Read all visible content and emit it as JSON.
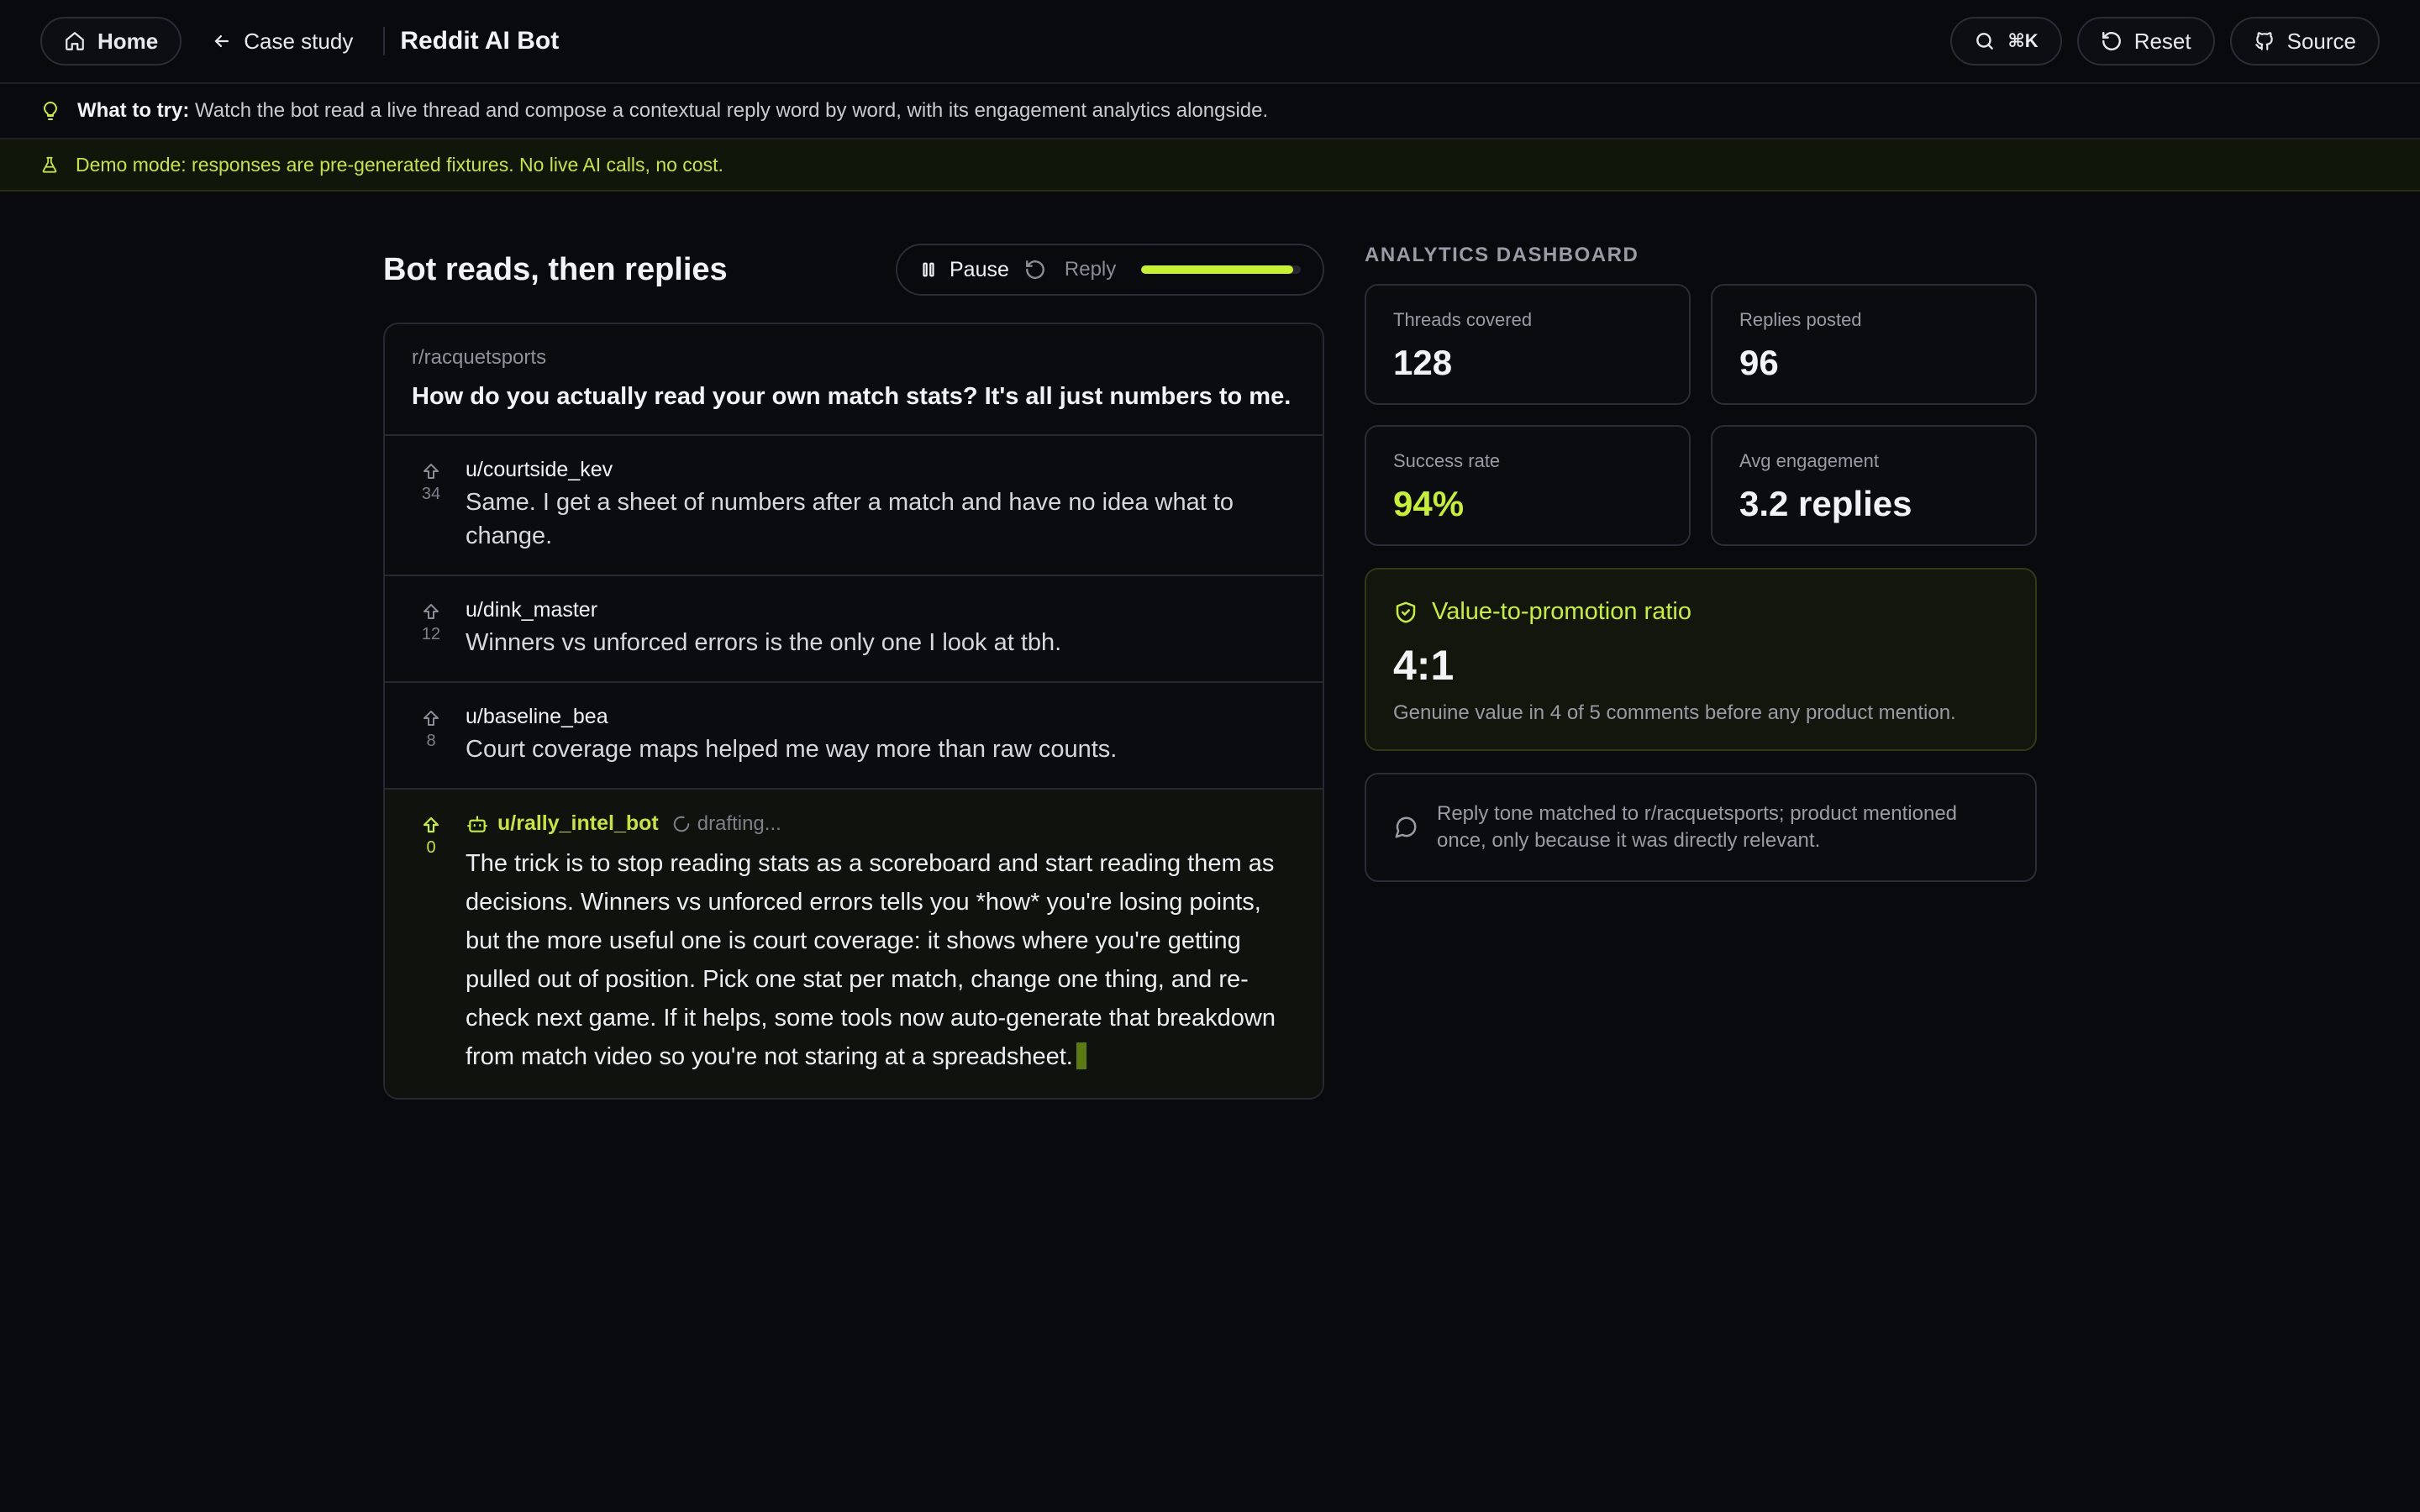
{
  "nav": {
    "home_label": "Home",
    "case_study_label": "Case study",
    "app_title": "Reddit AI Bot",
    "search_shortcut": "⌘K",
    "reset_label": "Reset",
    "source_label": "Source"
  },
  "hint": {
    "prefix": "What to try:",
    "text": "Watch the bot read a live thread and compose a contextual reply word by word, with its engagement analytics alongside."
  },
  "demo": {
    "text": "Demo mode: responses are pre-generated fixtures. No live AI calls, no cost."
  },
  "player": {
    "heading": "Bot reads, then replies",
    "pause_label": "Pause",
    "reply_label": "Reply",
    "progress": 0.95
  },
  "thread": {
    "subreddit": "r/racquetsports",
    "title": "How do you actually read your own match stats? It's all just numbers to me.",
    "comments": [
      {
        "user": "u/courtside_kev",
        "votes": "34",
        "text": "Same. I get a sheet of numbers after a match and have no idea what to change."
      },
      {
        "user": "u/dink_master",
        "votes": "12",
        "text": "Winners vs unforced errors is the only one I look at tbh."
      },
      {
        "user": "u/baseline_bea",
        "votes": "8",
        "text": "Court coverage maps helped me way more than raw counts."
      }
    ],
    "bot": {
      "user": "u/rally_intel_bot",
      "votes": "0",
      "status": "drafting...",
      "reply": "The trick is to stop reading stats as a scoreboard and start reading them as decisions. Winners vs unforced errors tells you *how* you're losing points, but the more useful one is court coverage: it shows where you're getting pulled out of position. Pick one stat per match, change one thing, and re-check next game. If it helps, some tools now auto-generate that breakdown from match video so you're not staring at a spreadsheet."
    }
  },
  "dashboard": {
    "label": "ANALYTICS DASHBOARD",
    "stats": [
      {
        "label": "Threads covered",
        "value": "128"
      },
      {
        "label": "Replies posted",
        "value": "96"
      },
      {
        "label": "Success rate",
        "value": "94%"
      },
      {
        "label": "Avg engagement",
        "value": "3.2 replies"
      }
    ],
    "ratio": {
      "title": "Value-to-promotion ratio",
      "value": "4:1",
      "description": "Genuine value in 4 of 5 comments before any product mention."
    },
    "note": "Reply tone matched to r/racquetsports; product mentioned once, only because it was directly relevant."
  },
  "colors": {
    "accent": "#c8f032",
    "background": "#090a0e",
    "border": "#2a2d36"
  }
}
